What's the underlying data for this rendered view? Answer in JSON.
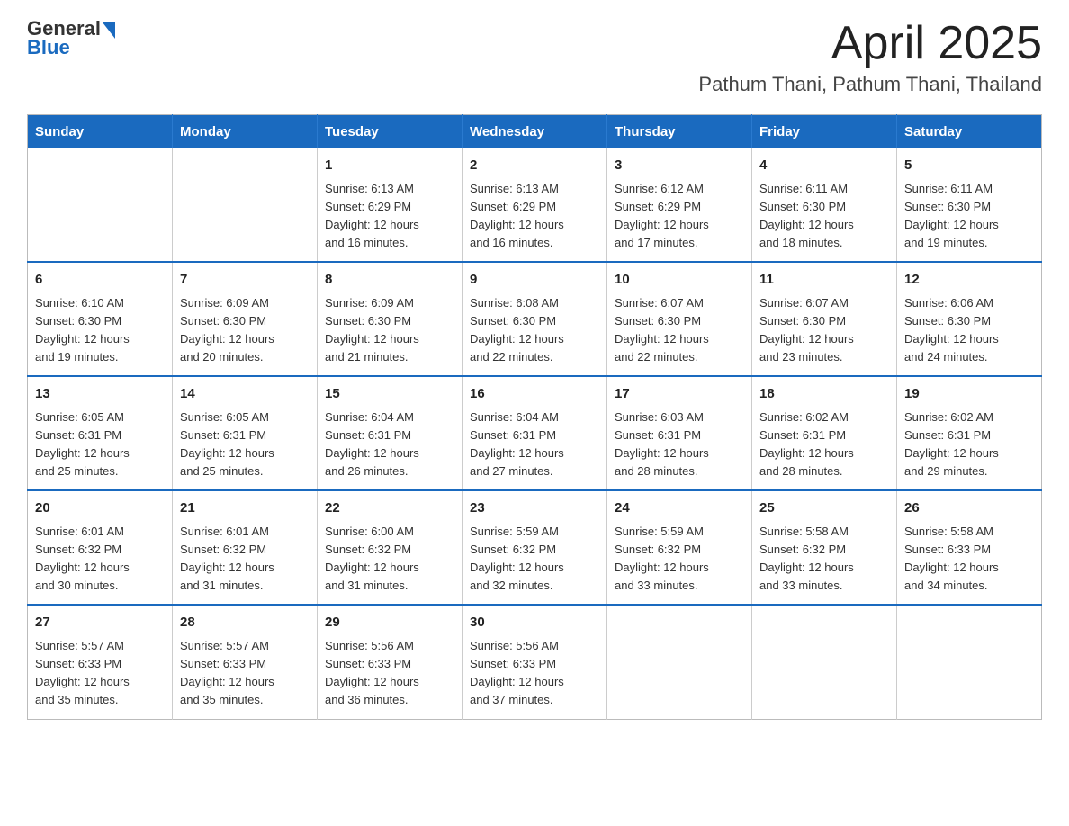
{
  "header": {
    "logo_line1": "General",
    "logo_line2": "Blue",
    "main_title": "April 2025",
    "subtitle": "Pathum Thani, Pathum Thani, Thailand"
  },
  "calendar": {
    "headers": [
      "Sunday",
      "Monday",
      "Tuesday",
      "Wednesday",
      "Thursday",
      "Friday",
      "Saturday"
    ],
    "weeks": [
      [
        {
          "day": "",
          "info": ""
        },
        {
          "day": "",
          "info": ""
        },
        {
          "day": "1",
          "info": "Sunrise: 6:13 AM\nSunset: 6:29 PM\nDaylight: 12 hours\nand 16 minutes."
        },
        {
          "day": "2",
          "info": "Sunrise: 6:13 AM\nSunset: 6:29 PM\nDaylight: 12 hours\nand 16 minutes."
        },
        {
          "day": "3",
          "info": "Sunrise: 6:12 AM\nSunset: 6:29 PM\nDaylight: 12 hours\nand 17 minutes."
        },
        {
          "day": "4",
          "info": "Sunrise: 6:11 AM\nSunset: 6:30 PM\nDaylight: 12 hours\nand 18 minutes."
        },
        {
          "day": "5",
          "info": "Sunrise: 6:11 AM\nSunset: 6:30 PM\nDaylight: 12 hours\nand 19 minutes."
        }
      ],
      [
        {
          "day": "6",
          "info": "Sunrise: 6:10 AM\nSunset: 6:30 PM\nDaylight: 12 hours\nand 19 minutes."
        },
        {
          "day": "7",
          "info": "Sunrise: 6:09 AM\nSunset: 6:30 PM\nDaylight: 12 hours\nand 20 minutes."
        },
        {
          "day": "8",
          "info": "Sunrise: 6:09 AM\nSunset: 6:30 PM\nDaylight: 12 hours\nand 21 minutes."
        },
        {
          "day": "9",
          "info": "Sunrise: 6:08 AM\nSunset: 6:30 PM\nDaylight: 12 hours\nand 22 minutes."
        },
        {
          "day": "10",
          "info": "Sunrise: 6:07 AM\nSunset: 6:30 PM\nDaylight: 12 hours\nand 22 minutes."
        },
        {
          "day": "11",
          "info": "Sunrise: 6:07 AM\nSunset: 6:30 PM\nDaylight: 12 hours\nand 23 minutes."
        },
        {
          "day": "12",
          "info": "Sunrise: 6:06 AM\nSunset: 6:30 PM\nDaylight: 12 hours\nand 24 minutes."
        }
      ],
      [
        {
          "day": "13",
          "info": "Sunrise: 6:05 AM\nSunset: 6:31 PM\nDaylight: 12 hours\nand 25 minutes."
        },
        {
          "day": "14",
          "info": "Sunrise: 6:05 AM\nSunset: 6:31 PM\nDaylight: 12 hours\nand 25 minutes."
        },
        {
          "day": "15",
          "info": "Sunrise: 6:04 AM\nSunset: 6:31 PM\nDaylight: 12 hours\nand 26 minutes."
        },
        {
          "day": "16",
          "info": "Sunrise: 6:04 AM\nSunset: 6:31 PM\nDaylight: 12 hours\nand 27 minutes."
        },
        {
          "day": "17",
          "info": "Sunrise: 6:03 AM\nSunset: 6:31 PM\nDaylight: 12 hours\nand 28 minutes."
        },
        {
          "day": "18",
          "info": "Sunrise: 6:02 AM\nSunset: 6:31 PM\nDaylight: 12 hours\nand 28 minutes."
        },
        {
          "day": "19",
          "info": "Sunrise: 6:02 AM\nSunset: 6:31 PM\nDaylight: 12 hours\nand 29 minutes."
        }
      ],
      [
        {
          "day": "20",
          "info": "Sunrise: 6:01 AM\nSunset: 6:32 PM\nDaylight: 12 hours\nand 30 minutes."
        },
        {
          "day": "21",
          "info": "Sunrise: 6:01 AM\nSunset: 6:32 PM\nDaylight: 12 hours\nand 31 minutes."
        },
        {
          "day": "22",
          "info": "Sunrise: 6:00 AM\nSunset: 6:32 PM\nDaylight: 12 hours\nand 31 minutes."
        },
        {
          "day": "23",
          "info": "Sunrise: 5:59 AM\nSunset: 6:32 PM\nDaylight: 12 hours\nand 32 minutes."
        },
        {
          "day": "24",
          "info": "Sunrise: 5:59 AM\nSunset: 6:32 PM\nDaylight: 12 hours\nand 33 minutes."
        },
        {
          "day": "25",
          "info": "Sunrise: 5:58 AM\nSunset: 6:32 PM\nDaylight: 12 hours\nand 33 minutes."
        },
        {
          "day": "26",
          "info": "Sunrise: 5:58 AM\nSunset: 6:33 PM\nDaylight: 12 hours\nand 34 minutes."
        }
      ],
      [
        {
          "day": "27",
          "info": "Sunrise: 5:57 AM\nSunset: 6:33 PM\nDaylight: 12 hours\nand 35 minutes."
        },
        {
          "day": "28",
          "info": "Sunrise: 5:57 AM\nSunset: 6:33 PM\nDaylight: 12 hours\nand 35 minutes."
        },
        {
          "day": "29",
          "info": "Sunrise: 5:56 AM\nSunset: 6:33 PM\nDaylight: 12 hours\nand 36 minutes."
        },
        {
          "day": "30",
          "info": "Sunrise: 5:56 AM\nSunset: 6:33 PM\nDaylight: 12 hours\nand 37 minutes."
        },
        {
          "day": "",
          "info": ""
        },
        {
          "day": "",
          "info": ""
        },
        {
          "day": "",
          "info": ""
        }
      ]
    ]
  }
}
